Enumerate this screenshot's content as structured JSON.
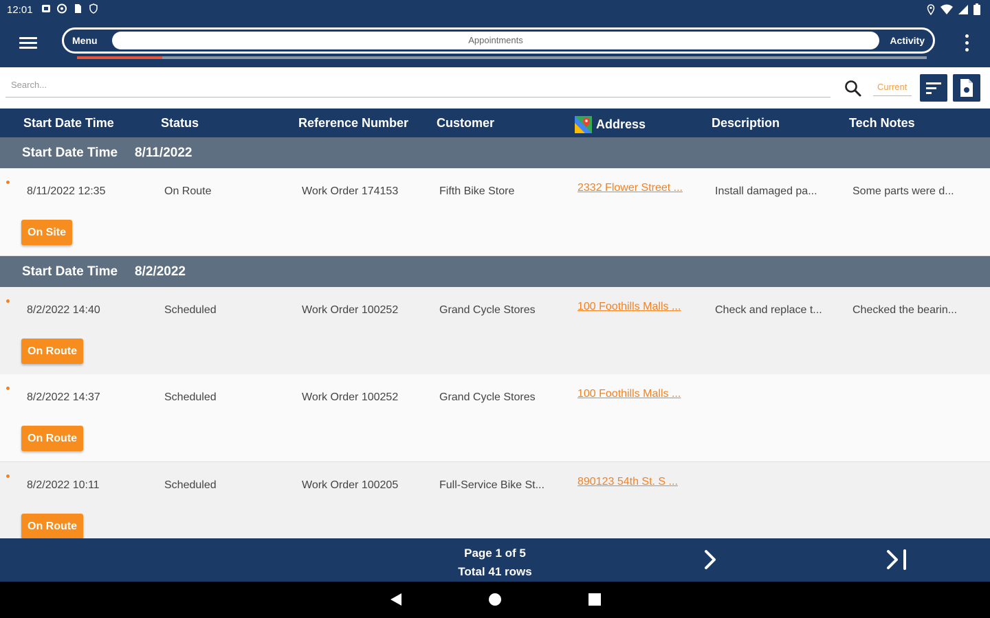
{
  "status_bar": {
    "time": "12:01",
    "left_icons": [
      "notification-icon",
      "notification-icon",
      "sd-card-icon",
      "shield-icon"
    ],
    "right_icons": [
      "location-icon",
      "wifi-icon",
      "signal-icon",
      "battery-icon"
    ]
  },
  "app_bar": {
    "menu_label": "Menu",
    "center_label": "Appointments",
    "activity_label": "Activity",
    "progress_fraction": 0.1
  },
  "search": {
    "placeholder": "Search...",
    "filter_placeholder": "Current"
  },
  "columns": [
    "Start Date Time",
    "Status",
    "Reference Number",
    "Customer",
    "Address",
    "Description",
    "Tech Notes"
  ],
  "groups": [
    {
      "label": "Start Date Time",
      "value": "8/11/2022",
      "rows": [
        {
          "start": "8/11/2022 12:35",
          "status": "On Route",
          "reference": "Work Order 174153",
          "customer": "Fifth Bike Store",
          "address": "2332 Flower Street ...",
          "description": "Install damaged pa...",
          "tech_notes": "Some parts were d...",
          "action": "On Site"
        }
      ]
    },
    {
      "label": "Start Date Time",
      "value": "8/2/2022",
      "rows": [
        {
          "start": "8/2/2022 14:40",
          "status": "Scheduled",
          "reference": "Work Order 100252",
          "customer": "Grand Cycle Stores",
          "address": "100 Foothills Malls ...",
          "description": "Check and replace t...",
          "tech_notes": "Checked the bearin...",
          "action": "On Route"
        },
        {
          "start": "8/2/2022 14:37",
          "status": "Scheduled",
          "reference": "Work Order 100252",
          "customer": "Grand Cycle Stores",
          "address": "100 Foothills Malls ...",
          "description": "",
          "tech_notes": "",
          "action": "On Route"
        },
        {
          "start": "8/2/2022 10:11",
          "status": "Scheduled",
          "reference": "Work Order 100205",
          "customer": "Full-Service Bike St...",
          "address": "890123 54th St. S ...",
          "description": "",
          "tech_notes": "",
          "action": "On Route"
        }
      ]
    }
  ],
  "pager": {
    "page_text": "Page 1 of 5",
    "total_text": "Total 41 rows"
  },
  "colors": {
    "primary": "#1c3a66",
    "group_header": "#5f6f82",
    "accent": "#f68d1e",
    "progress": "#e3573a"
  }
}
